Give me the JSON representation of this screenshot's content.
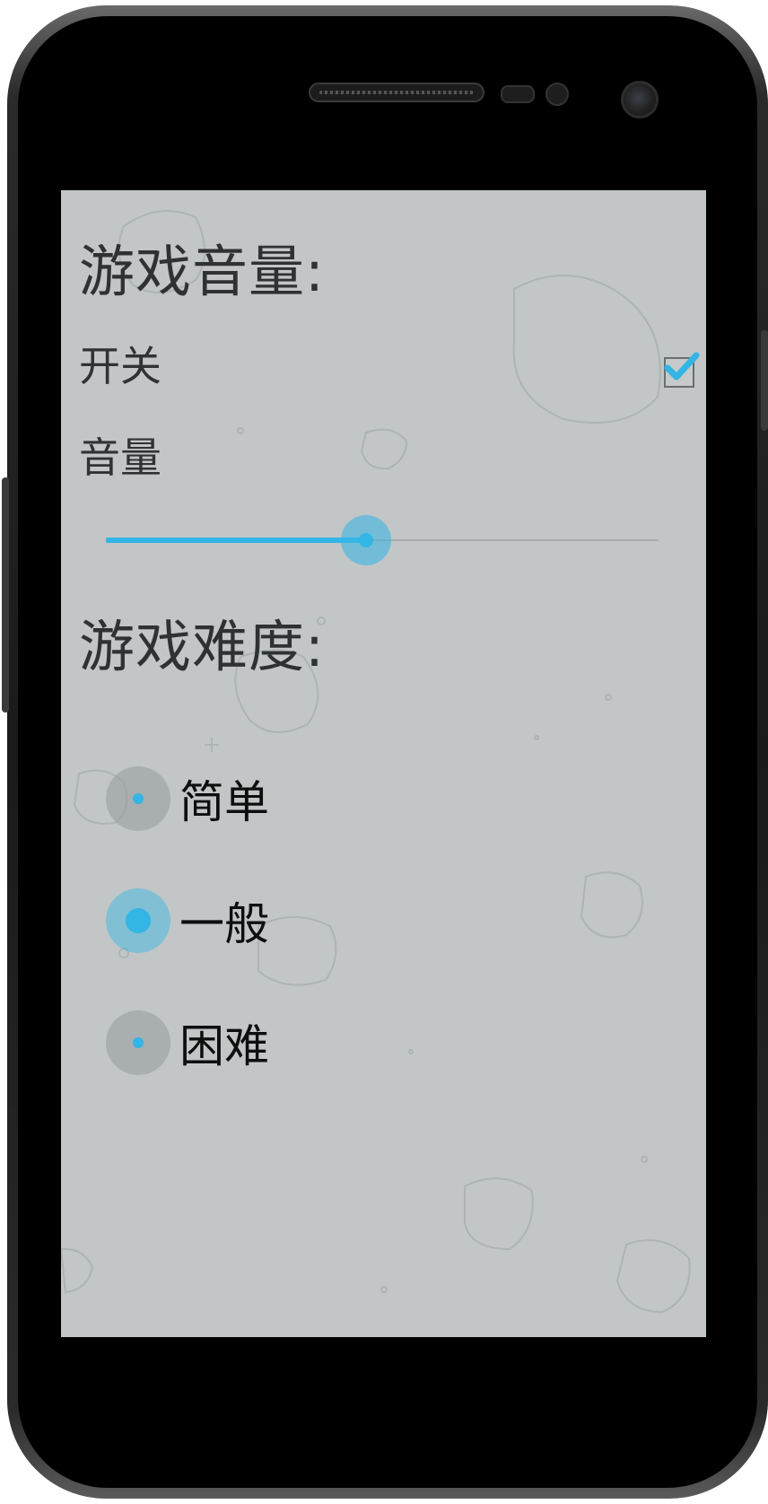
{
  "volume_section": {
    "title": "游戏音量:",
    "switch_label": "开关",
    "switch_checked": true,
    "volume_label": "音量",
    "volume_value": 0.47
  },
  "difficulty_section": {
    "title": "游戏难度:",
    "options": [
      {
        "label": "简单",
        "checked": false
      },
      {
        "label": "一般",
        "checked": true
      },
      {
        "label": "困难",
        "checked": false
      }
    ]
  },
  "colors": {
    "accent": "#33b5e5",
    "screen_background": "#c2c6c7",
    "text": "#303233"
  },
  "icons": {
    "checkbox": "checkmark-icon"
  }
}
